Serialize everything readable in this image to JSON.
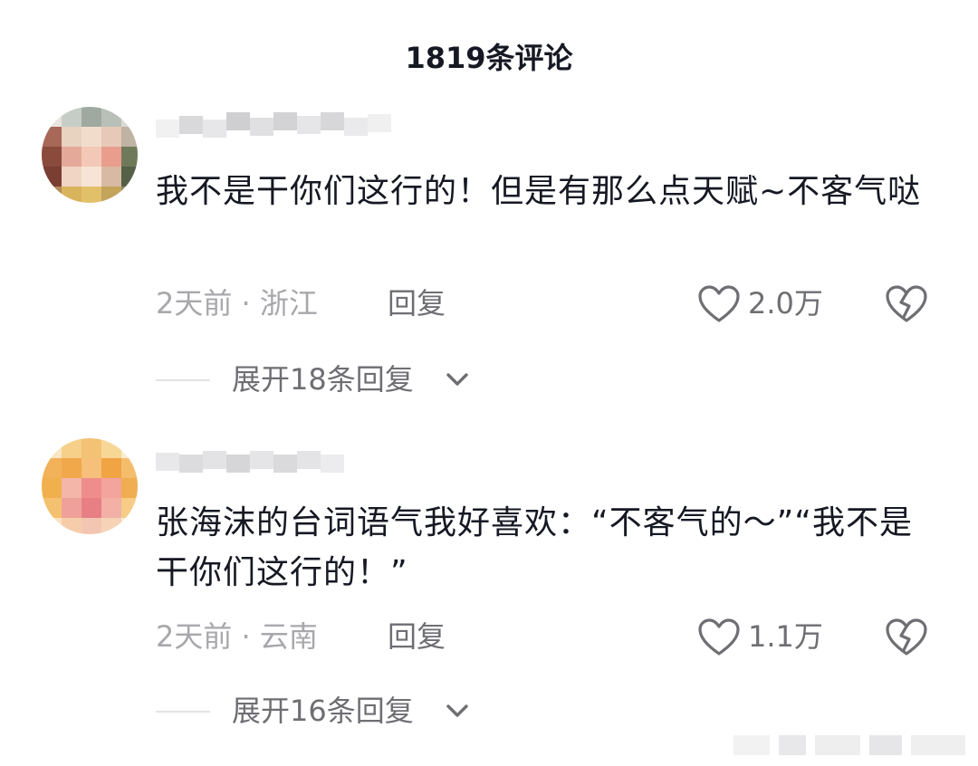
{
  "header": {
    "title": "1819条评论"
  },
  "comments": [
    {
      "text": "我不是干你们这行的！但是有那么点天赋~不客气哒",
      "time_location": "2天前 · 浙江",
      "reply_label": "回复",
      "like_count": "2.0万",
      "expand_label": "展开18条回复"
    },
    {
      "text": "张海沫的台词语气我好喜欢：“不客气的～”“我不是干你们这行的！”",
      "time_location": "2天前 · 云南",
      "reply_label": "回复",
      "like_count": "1.1万",
      "expand_label": "展开16条回复"
    }
  ],
  "icons": {
    "like": "heart-outline-icon",
    "dislike": "broken-heart-icon",
    "expand": "chevron-down-icon"
  },
  "colors": {
    "text_primary": "#161823",
    "text_secondary": "#a8a8ac",
    "text_action": "#6e6e73",
    "icon": "#6e6e73"
  }
}
